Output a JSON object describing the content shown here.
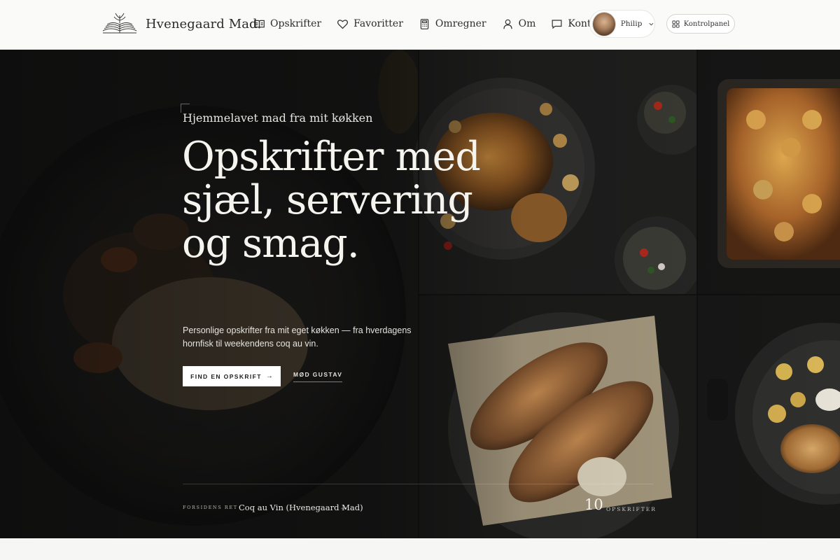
{
  "nav": {
    "brand": {
      "name": "Hvenegaard Mad",
      "icon": "open-book-logo-icon"
    },
    "links": [
      {
        "label": "Opskrifter",
        "icon": "book-icon"
      },
      {
        "label": "Favoritter",
        "icon": "heart-icon"
      },
      {
        "label": "Omregner",
        "icon": "calculator-icon"
      },
      {
        "label": "Om",
        "icon": "user-icon"
      },
      {
        "label": "Kontakt",
        "icon": "chat-icon"
      }
    ],
    "user": {
      "name": "Philip",
      "icon": "chevron-down-icon"
    },
    "control_panel": {
      "label": "Kontrolpanel",
      "icon": "grid-icon"
    }
  },
  "hero": {
    "kicker": "Hjemmelavet mad fra mit køkken",
    "headline": "Opskrifter med sjæl, servering og smag.",
    "lede": "Personlige opskrifter fra mit eget køkken — fra hverdagens hornfisk til weekendens coq au vin.",
    "primary_cta": "FIND EN OPSKRIFT",
    "primary_cta_arrow": "→",
    "secondary_cta": "MØD GUSTAV",
    "featured_label": "FORSIDENS RET",
    "featured_recipe": "Coq au Vin (Hvenegaard Mad)",
    "featured_arrow": "→",
    "recipe_count": "10",
    "recipe_count_label": "OPSKRIFTER"
  },
  "colors": {
    "nav_bg": "#fafaf9",
    "hero_text": "#f6f4ef",
    "hero_bg": "#141414",
    "button_bg": "#ffffff"
  }
}
